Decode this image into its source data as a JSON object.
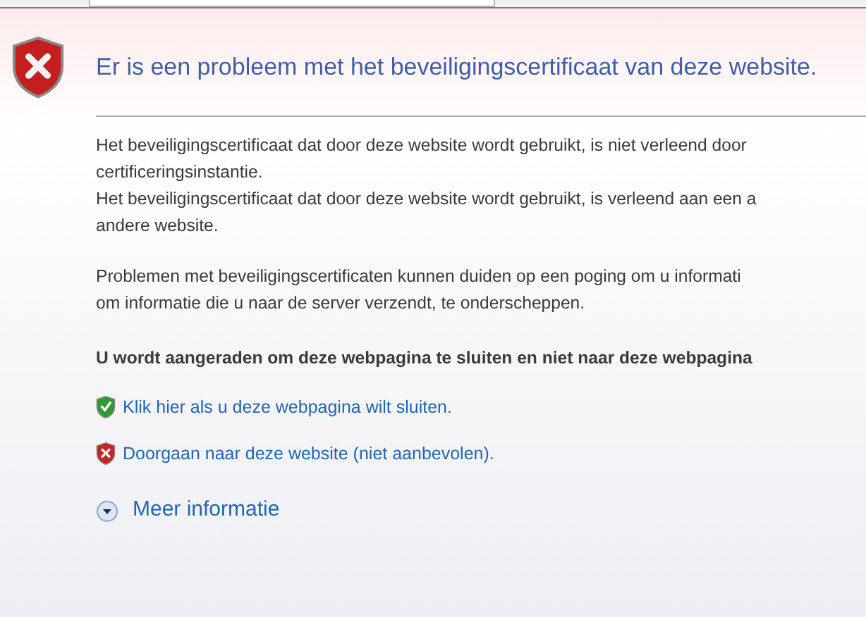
{
  "address_field": {
    "kind": "field"
  },
  "heading": "Er is een probleem met het beveiligingscertificaat van deze website.",
  "paragraphs": [
    [
      "Het beveiligingscertificaat dat door deze website wordt gebruikt, is niet verleend door",
      "certificeringsinstantie.",
      "Het beveiligingscertificaat dat door deze website wordt gebruikt, is verleend aan een a",
      "andere website."
    ],
    [
      "Problemen met beveiligingscertificaten kunnen duiden op een poging om u informati",
      "om informatie die u naar de server verzendt, te onderscheppen."
    ]
  ],
  "advice": "U wordt aangeraden om deze webpagina te sluiten en niet naar deze webpagina",
  "links": [
    {
      "kind": "safe",
      "label": "Klik hier als u deze webpagina wilt sluiten."
    },
    {
      "kind": "unsafe",
      "label": "Doorgaan naar deze website (niet aanbevolen)."
    }
  ],
  "more_info": {
    "label": "Meer informatie",
    "expanded": false
  }
}
